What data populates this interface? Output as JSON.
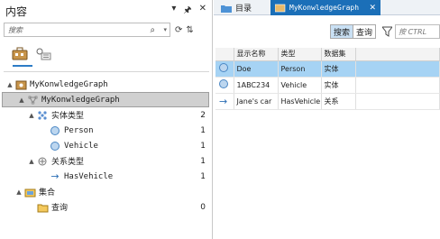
{
  "left_pane": {
    "title": "内容",
    "search_placeholder": "搜索",
    "tree": [
      {
        "label": "MyKonwledgeGraph",
        "count": "",
        "level": 0,
        "icon": "database-icon",
        "toggle": "▲"
      },
      {
        "label": "MyKonwledgeGraph",
        "count": "",
        "level": 1,
        "icon": "graph-icon",
        "toggle": "▲",
        "selected": true
      },
      {
        "label": "实体类型",
        "count": "2",
        "level": 2,
        "icon": "entity-types-icon",
        "toggle": "▲"
      },
      {
        "label": "Person",
        "count": "1",
        "level": 3,
        "icon": "entity-circle-icon",
        "toggle": ""
      },
      {
        "label": "Vehicle",
        "count": "1",
        "level": 3,
        "icon": "entity-circle-icon",
        "toggle": ""
      },
      {
        "label": "关系类型",
        "count": "1",
        "level": 2,
        "icon": "relationship-types-icon",
        "toggle": "▲"
      },
      {
        "label": "HasVehicle",
        "count": "1",
        "level": 3,
        "icon": "arrow-right-icon",
        "toggle": ""
      },
      {
        "label": "集合",
        "count": "",
        "level": 1,
        "icon": "collection-icon",
        "toggle": "▲"
      },
      {
        "label": "查询",
        "count": "0",
        "level": 2,
        "icon": "query-folder-icon",
        "toggle": ""
      }
    ]
  },
  "right_pane": {
    "tab_catalog": "目录",
    "tab_graph": "MyKonwledgeGraph",
    "btn_search": "搜索",
    "btn_query": "查询",
    "query_placeholder": "按 CTRL",
    "grid_headers": [
      "",
      "显示名称",
      "类型",
      "数据集"
    ],
    "rows": [
      {
        "icon": "circle",
        "name": "Doe",
        "type": "Person",
        "dataset": "实体",
        "selected": true
      },
      {
        "icon": "circle",
        "name": "1ABC234",
        "type": "Vehicle",
        "dataset": "实体",
        "selected": false
      },
      {
        "icon": "arrow",
        "name": "Jane's car",
        "type": "HasVehicle",
        "dataset": "关系",
        "selected": false
      }
    ]
  },
  "colors": {
    "accent": "#1b6fb8",
    "selection": "#a6d3f4"
  }
}
